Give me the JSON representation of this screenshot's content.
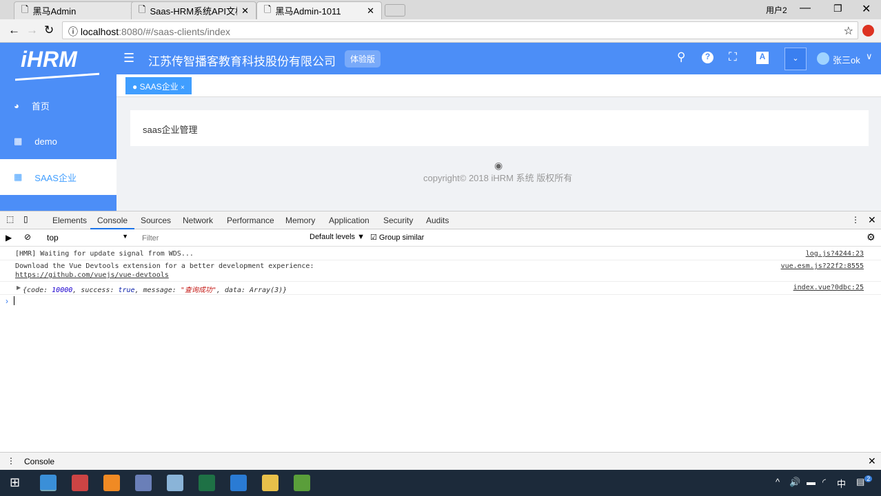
{
  "browser": {
    "tabs": [
      {
        "title": "黑马Admin"
      },
      {
        "title": "Saas-HRM系统API文档"
      },
      {
        "title": "黑马Admin-1011"
      }
    ],
    "user_label": "用户2",
    "url_host": "localhost",
    "url_rest": ":8080/#/saas-clients/index"
  },
  "app": {
    "logo": "iHRM",
    "company": "江苏传智播客教育科技股份有限公司",
    "badge": "体验版",
    "username": "张三ok",
    "sidebar": [
      {
        "label": "首页",
        "icon": "dashboard-icon"
      },
      {
        "label": "demo",
        "icon": "grid-icon"
      },
      {
        "label": "SAAS企业",
        "icon": "grid-icon"
      }
    ],
    "tag": "SAAS企业",
    "card_title": "saas企业管理",
    "copyright": "copyright© 2018 iHRM 系统 版权所有",
    "accent": "#4c8ef7"
  },
  "devtools": {
    "tabs": [
      "Elements",
      "Console",
      "Sources",
      "Network",
      "Performance",
      "Memory",
      "Application",
      "Security",
      "Audits"
    ],
    "context": "top",
    "filter_placeholder": "Filter",
    "levels": "Default levels ▼",
    "group_similar": "Group similar",
    "logs": [
      {
        "text": "[HMR] Waiting for update signal from WDS...",
        "source": "log.js?4244:23"
      },
      {
        "text": "Download the Vue Devtools extension for a better development experience:",
        "link": "https://github.com/vuejs/vue-devtools",
        "source": "vue.esm.js?22f2:8555"
      }
    ],
    "object_log": {
      "p1": "{code: ",
      "code": "10000",
      "p2": ", success: ",
      "success": "true",
      "p3": ", message: ",
      "message": "\"查询成功\"",
      "p4": ", data: Array(3)}",
      "source": "index.vue?0dbc:25"
    },
    "drawer": "Console"
  },
  "taskbar": {
    "ime": "中",
    "notifications": "2"
  }
}
